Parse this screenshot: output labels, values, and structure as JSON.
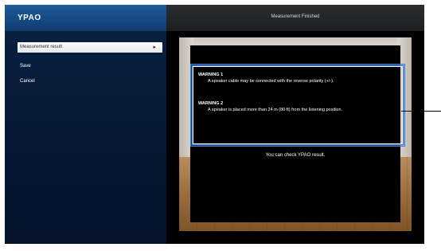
{
  "app_title": "YPAO",
  "menu": {
    "items": [
      {
        "label": "Measurement result",
        "value": "▸",
        "selected": true
      },
      {
        "label": "Save",
        "value": "",
        "selected": false
      },
      {
        "label": "Cancel",
        "value": "",
        "selected": false
      }
    ]
  },
  "result_panel": {
    "title": "Measurement Finished",
    "warnings": [
      {
        "heading": "WARNING 1",
        "message": "A speaker cable may be connected with the reverse polarity (+/-)."
      },
      {
        "heading": "WARNING 2",
        "message": "A speaker is placed more than 24 m (80 ft) from the listening position."
      }
    ],
    "footer": "You can check YPAO result."
  },
  "colors": {
    "header_blue": "#1f5a9a",
    "highlight_border": "#3f7fd9",
    "selected_bg": "#ffffff"
  }
}
